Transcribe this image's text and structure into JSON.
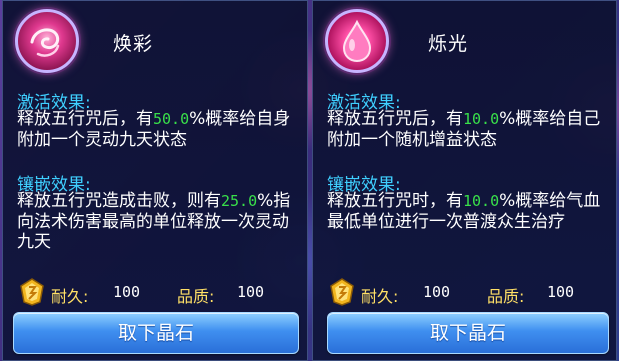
{
  "left": {
    "icon": "swirl-gem-icon",
    "title": "焕彩",
    "activate_title": "激活效果:",
    "activate_text": {
      "a": "释放五行咒后，有",
      "pct": "50.0",
      "b": "%概率给自身附加一个灵动九天状态"
    },
    "inlay_title": "镶嵌效果:",
    "inlay_text": {
      "a": "释放五行咒造成击败，则有",
      "pct": "25.0",
      "b": "%指向法术伤害最高的单位释放一次灵动九天"
    },
    "durability_label": "耐久:",
    "durability_value": "100",
    "quality_label": "品质:",
    "quality_value": "100",
    "button_label": "取下晶石"
  },
  "right": {
    "icon": "drop-gem-icon",
    "title": "烁光",
    "activate_title": "激活效果:",
    "activate_text": {
      "a": "释放五行咒后，有",
      "pct": "10.0",
      "b": "%概率给自己附加一个随机增益状态"
    },
    "inlay_title": "镶嵌效果:",
    "inlay_text": {
      "a": "释放五行咒时，有",
      "pct": "10.0",
      "b": "%概率给气血最低单位进行一次普渡众生治疗"
    },
    "durability_label": "耐久:",
    "durability_value": "100",
    "quality_label": "品质:",
    "quality_value": "100",
    "button_label": "取下晶石"
  },
  "colors": {
    "section": "#3fd0ff",
    "highlight": "#39e04a",
    "stat_label": "#ffe066",
    "button": "#3f8ff0"
  }
}
